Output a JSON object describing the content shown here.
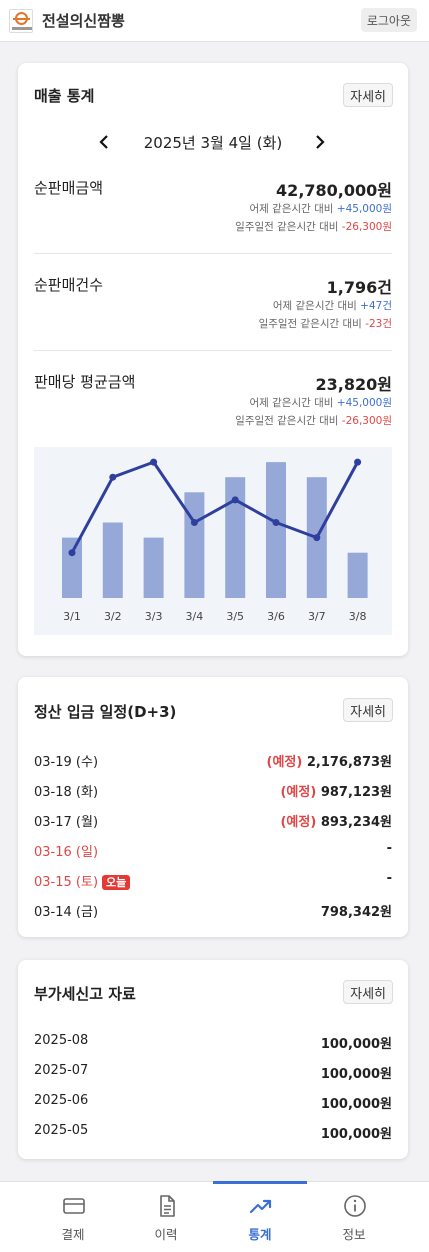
{
  "header": {
    "title": "전설의신짬뽕",
    "logout_label": "로그아웃"
  },
  "sales": {
    "title": "매출 통계",
    "detail_label": "자세히",
    "date": "2025년 3월 4일 (화)",
    "stats": [
      {
        "label": "순판매금액",
        "value": "42,780,000원",
        "cmp1_label": "어제 같은시간 대비",
        "cmp1_value": "+45,000원",
        "cmp2_label": "일주일전 같은시간 대비",
        "cmp2_value": "-26,300원"
      },
      {
        "label": "순판매건수",
        "value": "1,796건",
        "cmp1_label": "어제 같은시간 대비",
        "cmp1_value": "+47건",
        "cmp2_label": "일주일전 같은시간 대비",
        "cmp2_value": "-23건"
      },
      {
        "label": "판매당 평균금액",
        "value": "23,820원",
        "cmp1_label": "어제 같은시간 대비",
        "cmp1_value": "+45,000원",
        "cmp2_label": "일주일전 같은시간 대비",
        "cmp2_value": "-26,300원"
      }
    ]
  },
  "chart_data": {
    "type": "bar",
    "categories": [
      "3/1",
      "3/2",
      "3/3",
      "3/4",
      "3/5",
      "3/6",
      "3/7",
      "3/8"
    ],
    "series": [
      {
        "type": "bar",
        "values": [
          4,
          5,
          4,
          7,
          8,
          9,
          8,
          3
        ]
      },
      {
        "type": "line",
        "values": [
          3,
          8,
          9,
          5,
          6.5,
          5,
          4,
          9
        ]
      }
    ],
    "ylim": [
      0,
      10
    ],
    "grid": false,
    "colors": {
      "bar": "#96a8d8",
      "line": "#2f3f9e",
      "background": "#f1f4f9"
    }
  },
  "settlement": {
    "title": "정산 입금 일정(D+3)",
    "detail_label": "자세히",
    "rows": [
      {
        "date": "03-19 (수)",
        "tag": "(예정)",
        "amount": "2,176,873원"
      },
      {
        "date": "03-18 (화)",
        "tag": "(예정)",
        "amount": "987,123원"
      },
      {
        "date": "03-17 (월)",
        "tag": "(예정)",
        "amount": "893,234원"
      },
      {
        "date": "03-16 (일)",
        "tag": "",
        "amount": "-"
      },
      {
        "date": "03-15 (토)",
        "tag": "",
        "amount": "-",
        "badge": "오늘"
      },
      {
        "date": "03-14 (금)",
        "tag": "",
        "amount": "798,342원"
      }
    ]
  },
  "vat": {
    "title": "부가세신고 자료",
    "detail_label": "자세히",
    "rows": [
      {
        "period": "2025-08",
        "amount": "100,000원"
      },
      {
        "period": "2025-07",
        "amount": "100,000원"
      },
      {
        "period": "2025-06",
        "amount": "100,000원"
      },
      {
        "period": "2025-05",
        "amount": "100,000원"
      }
    ]
  },
  "nav": {
    "items": [
      {
        "label": "결제",
        "icon": "card-icon"
      },
      {
        "label": "이력",
        "icon": "document-icon"
      },
      {
        "label": "통계",
        "icon": "trend-icon",
        "active": true
      },
      {
        "label": "정보",
        "icon": "info-icon"
      }
    ]
  },
  "colors": {
    "accent": "#3b6fd6",
    "negative": "#e04646",
    "today_badge": "#e53935"
  }
}
